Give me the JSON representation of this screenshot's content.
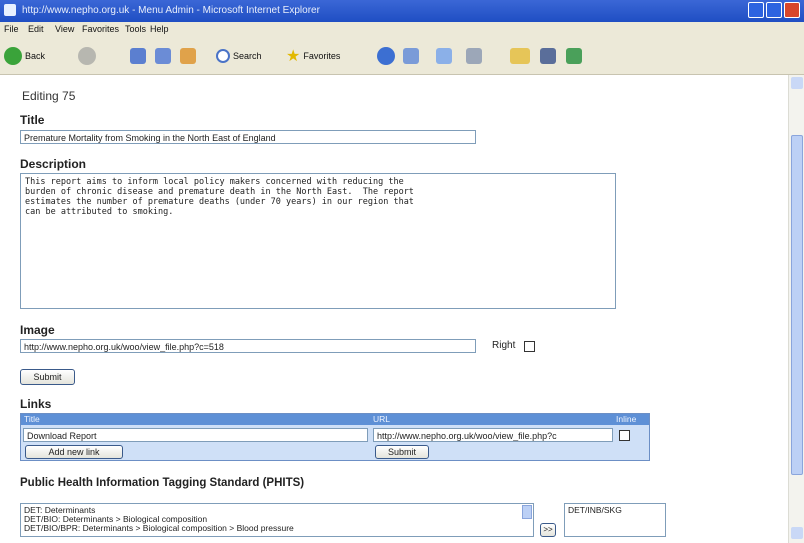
{
  "window": {
    "title": "http://www.nepho.org.uk - Menu Admin - Microsoft Internet Explorer"
  },
  "menu": [
    "File",
    "Edit",
    "View",
    "Favorites",
    "Tools",
    "Help"
  ],
  "toolbar": {
    "back_label": "Back",
    "search_label": "Search",
    "favorites_label": "Favorites"
  },
  "page": {
    "editing": "Editing 75",
    "title_heading": "Title",
    "title_value": "Premature Mortality from Smoking in the North East of England",
    "description_heading": "Description",
    "description_value": "This report aims to inform local policy makers concerned with reducing the\nburden of chronic disease and premature death in the North East.  The report\nestimates the number of premature deaths (under 70 years) in our region that\ncan be attributed to smoking.",
    "image_heading": "Image",
    "image_value": "http://www.nepho.org.uk/woo/view_file.php?c=518",
    "right_label": "Right",
    "submit_label": "Submit",
    "links_heading": "Links",
    "links_columns": {
      "title": "Title",
      "url": "URL",
      "inline": "Inline"
    },
    "link_title_value": "Download Report",
    "link_url_value": "http://www.nepho.org.uk/woo/view_file.php?c",
    "add_link_label": "Add new link",
    "links_submit_label": "Submit",
    "phits_heading": "Public Health Information Tagging Standard (PHITS)",
    "phits_options": [
      "DET: Determinants",
      "DET/BIO: Determinants > Biological composition",
      "DET/BIO/BPR: Determinants > Biological composition > Blood pressure"
    ],
    "move_button_label": ">>",
    "selected_tags": [
      "DET/INB/SKG"
    ]
  }
}
